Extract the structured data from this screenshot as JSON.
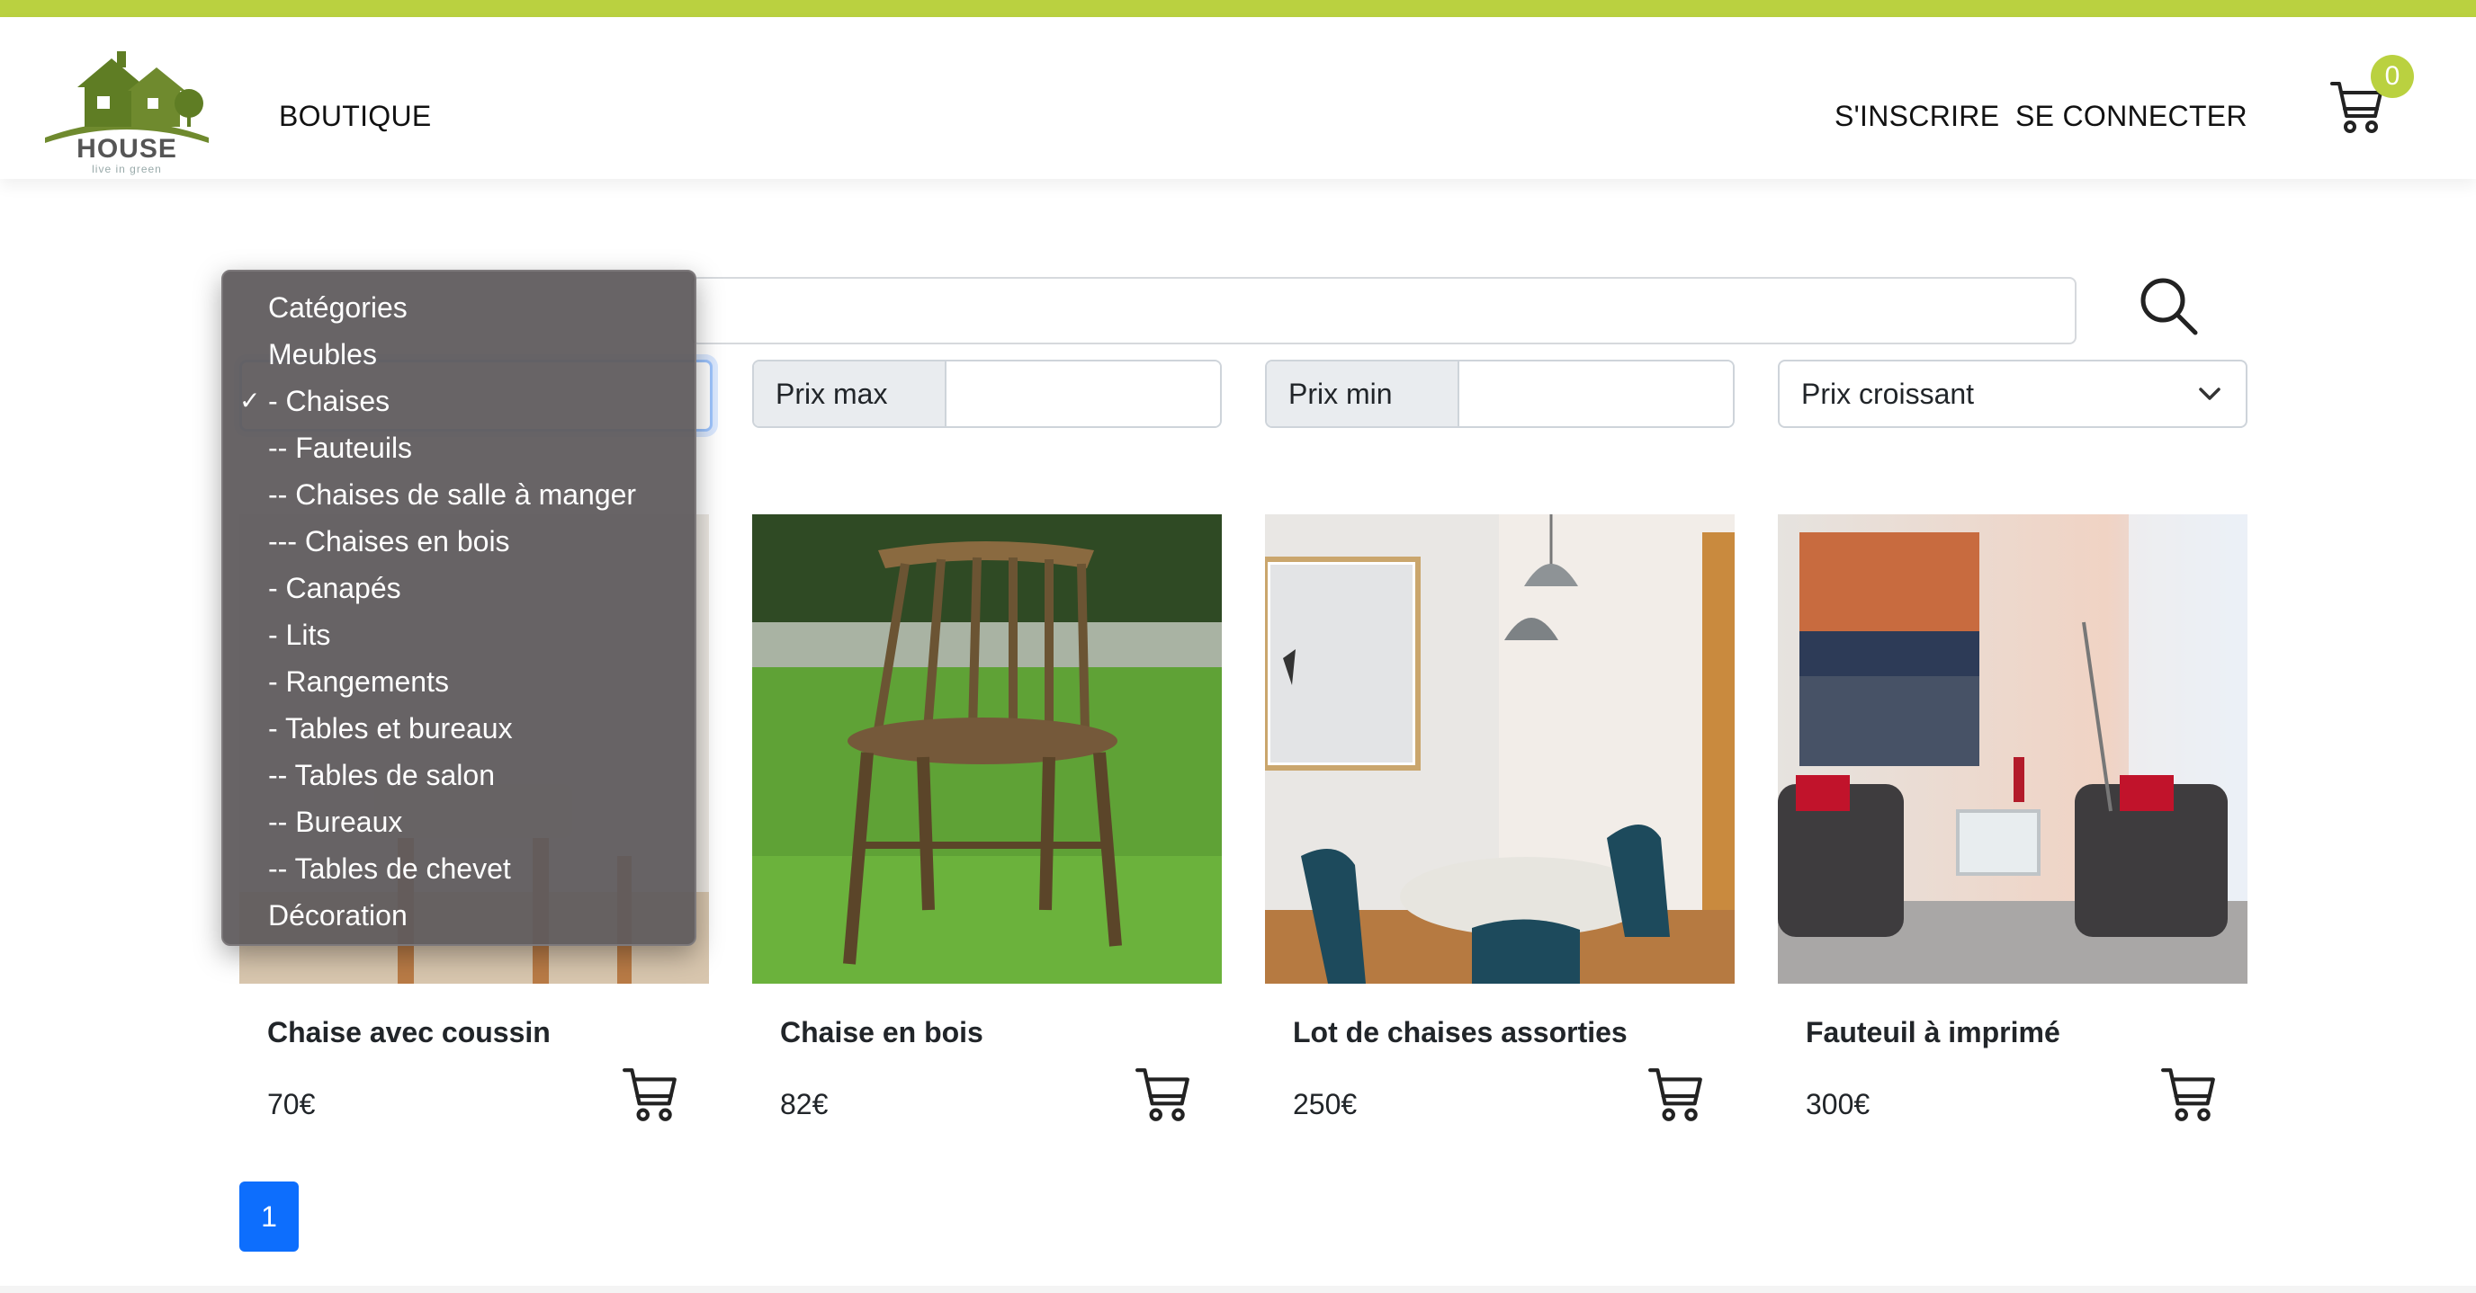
{
  "header": {
    "logo_text": "HOUSE",
    "logo_tagline": "live in green",
    "nav": {
      "shop": "BOUTIQUE",
      "register": "S'INSCRIRE",
      "login": "SE CONNECTER"
    },
    "cart_count": "0",
    "accent_color": "#bad140"
  },
  "search": {
    "value": "",
    "icon": "search-icon"
  },
  "filters": {
    "category_dropdown": {
      "selected": "- Chaises",
      "options": [
        "Catégories",
        "Meubles",
        "- Chaises",
        "-- Fauteuils",
        "-- Chaises de salle à manger",
        "--- Chaises en bois",
        "- Canapés",
        "- Lits",
        "- Rangements",
        "- Tables et bureaux",
        "-- Tables de salon",
        "-- Bureaux",
        "-- Tables de chevet",
        "Décoration"
      ]
    },
    "max_price_label": "Prix max",
    "min_price_label": "Prix min",
    "sort_value": "Prix croissant"
  },
  "products": [
    {
      "title": "Chaise avec coussin",
      "price": "70€"
    },
    {
      "title": "Chaise en bois",
      "price": "82€"
    },
    {
      "title": "Lot de chaises assorties",
      "price": "250€"
    },
    {
      "title": "Fauteuil à imprimé",
      "price": "300€"
    }
  ],
  "pagination": {
    "current": "1",
    "active_color": "#0d6efd"
  }
}
